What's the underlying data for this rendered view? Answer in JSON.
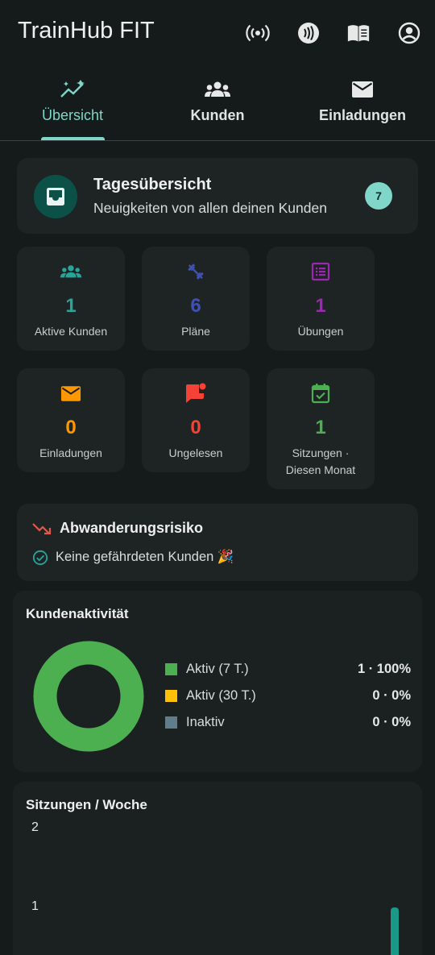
{
  "app": {
    "title": "TrainHub FIT",
    "actions": [
      {
        "name": "broadcast-icon"
      },
      {
        "name": "nfc-icon"
      },
      {
        "name": "book-icon"
      },
      {
        "name": "account-icon"
      }
    ]
  },
  "tabs": [
    {
      "label": "Übersicht",
      "icon": "trending-up-icon",
      "active": true
    },
    {
      "label": "Kunden",
      "icon": "groups-icon",
      "active": false
    },
    {
      "label": "Einladungen",
      "icon": "mail-icon",
      "active": false
    }
  ],
  "summary": {
    "title": "Tagesübersicht",
    "subtitle": "Neuigkeiten von allen deinen Kunden",
    "badge": "7",
    "icon": "inbox-icon"
  },
  "stats": [
    {
      "value": "1",
      "label": "Aktive Kunden",
      "icon": "groups-icon",
      "color": "#26a69a"
    },
    {
      "value": "6",
      "label": "Pläne",
      "icon": "dumbbell-icon",
      "color": "#3f51b5"
    },
    {
      "value": "1",
      "label": "Übungen",
      "icon": "list-icon",
      "color": "#9c27b0"
    },
    {
      "value": "0",
      "label": "Einladungen",
      "icon": "mail-icon",
      "color": "#ff9800"
    },
    {
      "value": "0",
      "label": "Ungelesen",
      "icon": "chat-alert-icon",
      "color": "#f44336"
    },
    {
      "value": "1",
      "label": "Sitzungen ·",
      "label2": "Diesen Monat",
      "icon": "calendar-check-icon",
      "color": "#4caf50"
    }
  ],
  "churn": {
    "title": "Abwanderungsrisiko",
    "text": "Keine gefährdeten Kunden 🎉",
    "icon": "trending-down-icon",
    "check_icon": "check-circle-icon"
  },
  "activity": {
    "title": "Kundenaktivität",
    "legend": [
      {
        "label": "Aktiv (7 T.)",
        "value": "1 · 100%",
        "color": "#4caf50"
      },
      {
        "label": "Aktiv (30 T.)",
        "value": "0 · 0%",
        "color": "#ffc107"
      },
      {
        "label": "Inaktiv",
        "value": "0 · 0%",
        "color": "#607d8b"
      }
    ]
  },
  "chart_data": [
    {
      "type": "pie",
      "title": "Kundenaktivität",
      "categories": [
        "Aktiv (7 T.)",
        "Aktiv (30 T.)",
        "Inaktiv"
      ],
      "values": [
        1,
        0,
        0
      ],
      "percent_labels": [
        "100%",
        "0%",
        "0%"
      ],
      "colors": [
        "#4caf50",
        "#ffc107",
        "#607d8b"
      ],
      "donut": true,
      "legend": "right"
    },
    {
      "type": "bar",
      "title": "Sitzungen / Woche",
      "y_ticks": [
        "2",
        "1"
      ],
      "ylim": [
        0,
        2
      ],
      "values": [
        1.0
      ],
      "color": "#1a9888",
      "note": "only the last (most recent) bar is visible; chart continues below the viewport"
    }
  ],
  "sessions": {
    "title": "Sitzungen / Woche",
    "y_ticks": [
      "2",
      "1"
    ]
  }
}
